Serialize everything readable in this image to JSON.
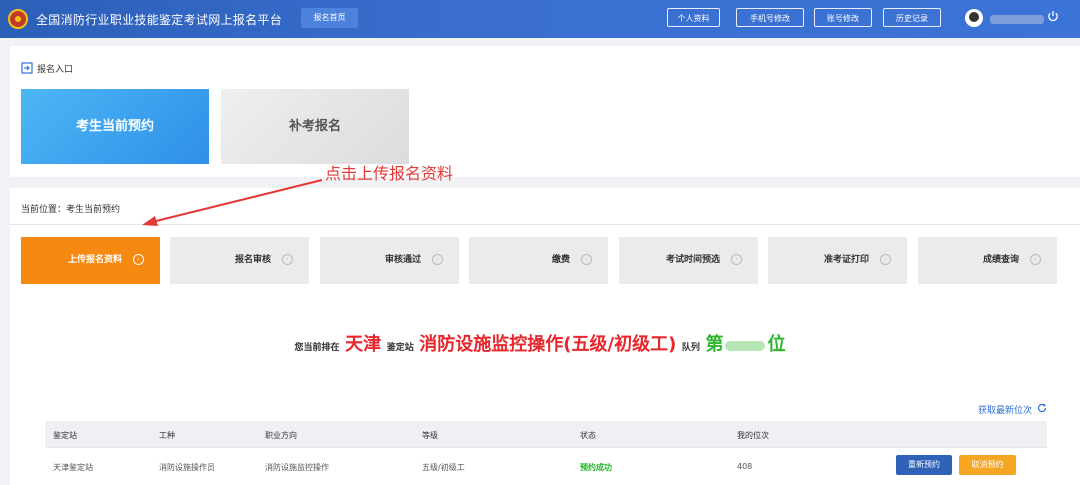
{
  "header": {
    "title": "全国消防行业职业技能鉴定考试网上报名平台",
    "nav_home": "报名首页",
    "buttons": [
      "个人资料",
      "手机号修改",
      "账号修改",
      "历史记录"
    ],
    "icons": [
      "logo-emblem",
      "user-avatar",
      "power-icon"
    ]
  },
  "entry": {
    "label": "报名入口",
    "cards": [
      "考生当前预约",
      "补考报名"
    ]
  },
  "annotation": "点击上传报名资料",
  "breadcrumb": "当前位置：考生当前预约",
  "steps": [
    "上传报名资料",
    "报名审核",
    "审核通过",
    "缴费",
    "考试时间预选",
    "准考证打印",
    "成绩查询"
  ],
  "steps_active_index": 0,
  "queue": {
    "prefix": "您当前排在",
    "city": "天津",
    "station_label": "鉴定站",
    "job": "消防设施监控操作(五级/初级工)",
    "queue_label": "队列",
    "rank_prefix": "第",
    "rank_suffix": "位"
  },
  "refresh_label": "获取最新位次",
  "table": {
    "headers": [
      "鉴定站",
      "工种",
      "职业方向",
      "等级",
      "状态",
      "我的位次"
    ],
    "row": [
      "天津鉴定站",
      "消防设施操作员",
      "消防设施监控操作",
      "五级/初级工",
      "预约成功",
      "408"
    ],
    "actions": [
      "重新预约",
      "取消预约"
    ]
  },
  "colors": {
    "topbar": "#3a6fd0",
    "active_step": "#f68a10",
    "annotation": "#e53935",
    "success": "#22b322"
  }
}
